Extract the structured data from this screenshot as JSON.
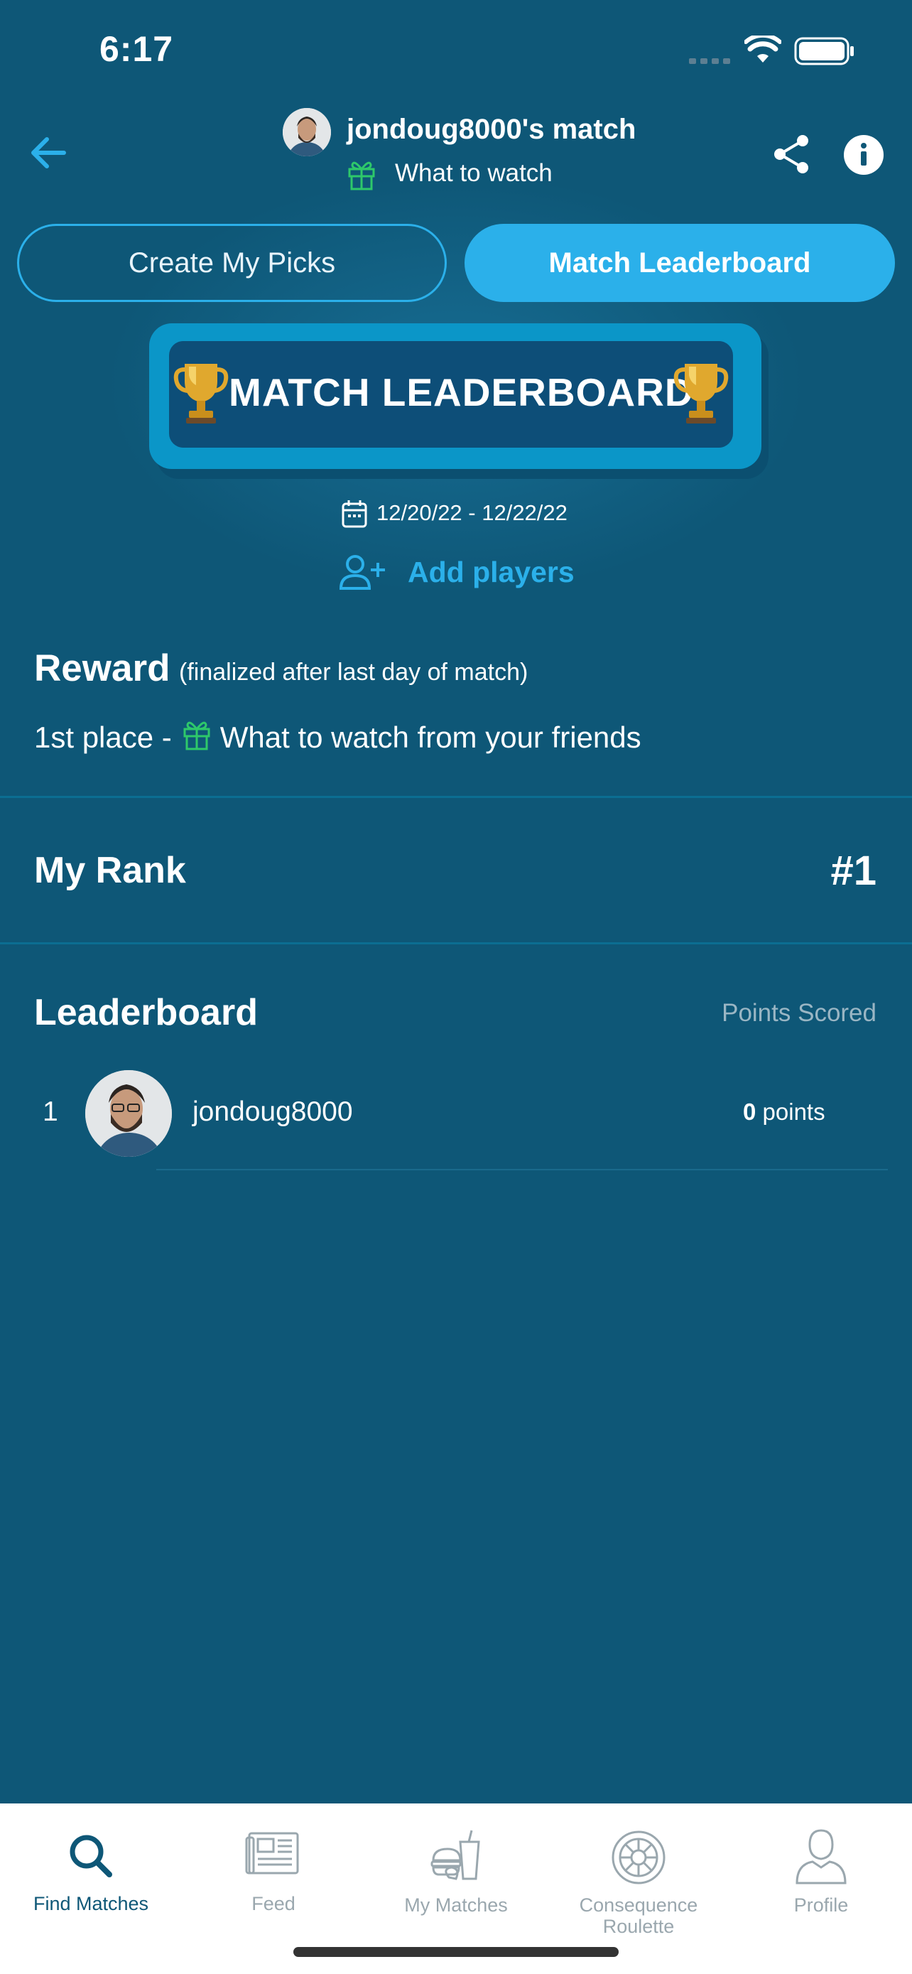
{
  "status_bar": {
    "time": "6:17"
  },
  "header": {
    "title": "jondoug8000's match",
    "subtitle": "What to watch"
  },
  "segments": {
    "picks_label": "Create My Picks",
    "leaderboard_label": "Match Leaderboard",
    "selected": "Match Leaderboard"
  },
  "banner": {
    "text": "MATCH LEADERBOARD"
  },
  "date_range": "12/20/22 - 12/22/22",
  "add_players_label": "Add players",
  "reward": {
    "title": "Reward",
    "note": "(finalized after last day of match)",
    "place": "1st place -",
    "prize": "What to watch from your friends"
  },
  "my_rank": {
    "label": "My Rank",
    "value": "#1"
  },
  "leaderboard": {
    "title": "Leaderboard",
    "column": "Points Scored",
    "rows": [
      {
        "rank": "1",
        "name": "jondoug8000",
        "points": "0",
        "points_unit": "points"
      }
    ]
  },
  "tabs": [
    {
      "label": "Find Matches",
      "icon": "search-icon",
      "active": true
    },
    {
      "label": "Feed",
      "icon": "newspaper-icon",
      "active": false
    },
    {
      "label": "My Matches",
      "icon": "food-icon",
      "active": false
    },
    {
      "label": "Consequence Roulette",
      "icon": "wheel-icon",
      "active": false
    },
    {
      "label": "Profile",
      "icon": "person-icon",
      "active": false
    }
  ],
  "colors": {
    "background": "#0e5777",
    "accent": "#2bb0ea",
    "gift": "#2ec86a"
  }
}
